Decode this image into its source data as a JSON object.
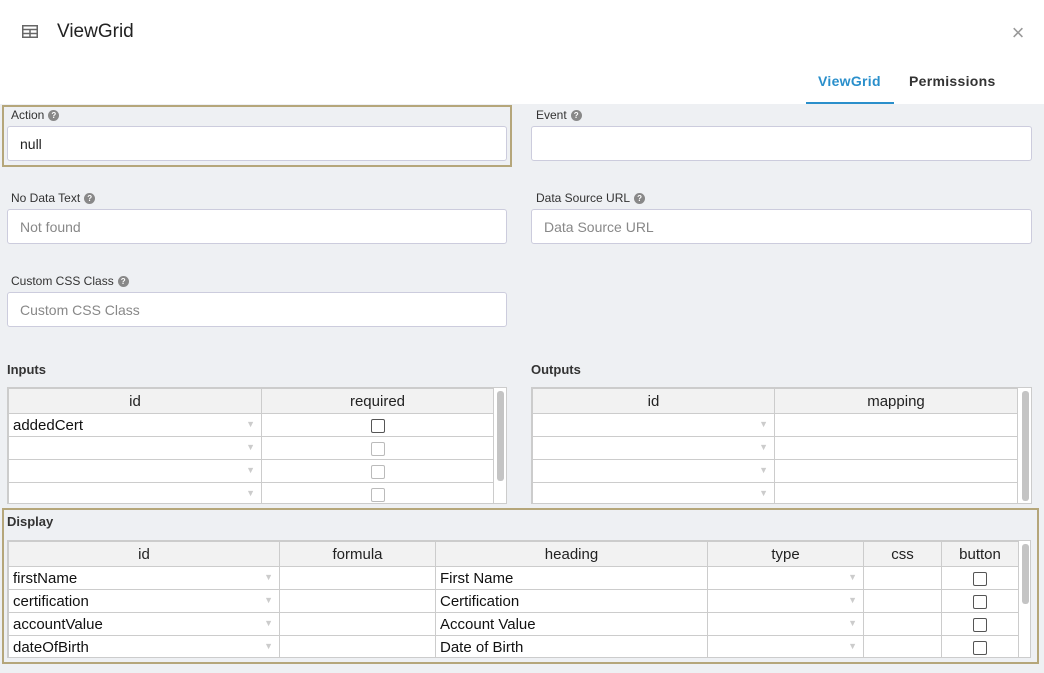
{
  "header": {
    "title": "ViewGrid",
    "icon": "table-icon",
    "close": "×",
    "tabs": [
      {
        "label": "ViewGrid",
        "active": true
      },
      {
        "label": "Permissions",
        "active": false
      }
    ]
  },
  "form": {
    "action": {
      "label": "Action",
      "value": "null"
    },
    "event": {
      "label": "Event",
      "value": ""
    },
    "no_data_text": {
      "label": "No Data Text",
      "placeholder": "Not found"
    },
    "data_source_url": {
      "label": "Data Source URL",
      "placeholder": "Data Source URL"
    },
    "custom_css_class": {
      "label": "Custom CSS Class",
      "placeholder": "Custom CSS Class"
    }
  },
  "inputs": {
    "title": "Inputs",
    "columns": [
      "id",
      "required"
    ],
    "rows": [
      {
        "id": "addedCert",
        "required": false
      },
      {
        "id": "",
        "required": false
      },
      {
        "id": "",
        "required": false
      },
      {
        "id": "",
        "required": false
      }
    ]
  },
  "outputs": {
    "title": "Outputs",
    "columns": [
      "id",
      "mapping"
    ],
    "rows": [
      {
        "id": "",
        "mapping": ""
      },
      {
        "id": "",
        "mapping": ""
      },
      {
        "id": "",
        "mapping": ""
      },
      {
        "id": "",
        "mapping": ""
      }
    ]
  },
  "display": {
    "title": "Display",
    "columns": [
      "id",
      "formula",
      "heading",
      "type",
      "css",
      "button"
    ],
    "rows": [
      {
        "id": "firstName",
        "formula": "",
        "heading": "First Name",
        "type": "",
        "css": "",
        "button": false
      },
      {
        "id": "certification",
        "formula": "",
        "heading": "Certification",
        "type": "",
        "css": "",
        "button": false
      },
      {
        "id": "accountValue",
        "formula": "",
        "heading": "Account Value",
        "type": "",
        "css": "",
        "button": false
      },
      {
        "id": "dateOfBirth",
        "formula": "",
        "heading": "Date of Birth",
        "type": "",
        "css": "",
        "button": false
      }
    ]
  },
  "colors": {
    "accent": "#2a8fcb",
    "highlight": "#b5a67a"
  }
}
